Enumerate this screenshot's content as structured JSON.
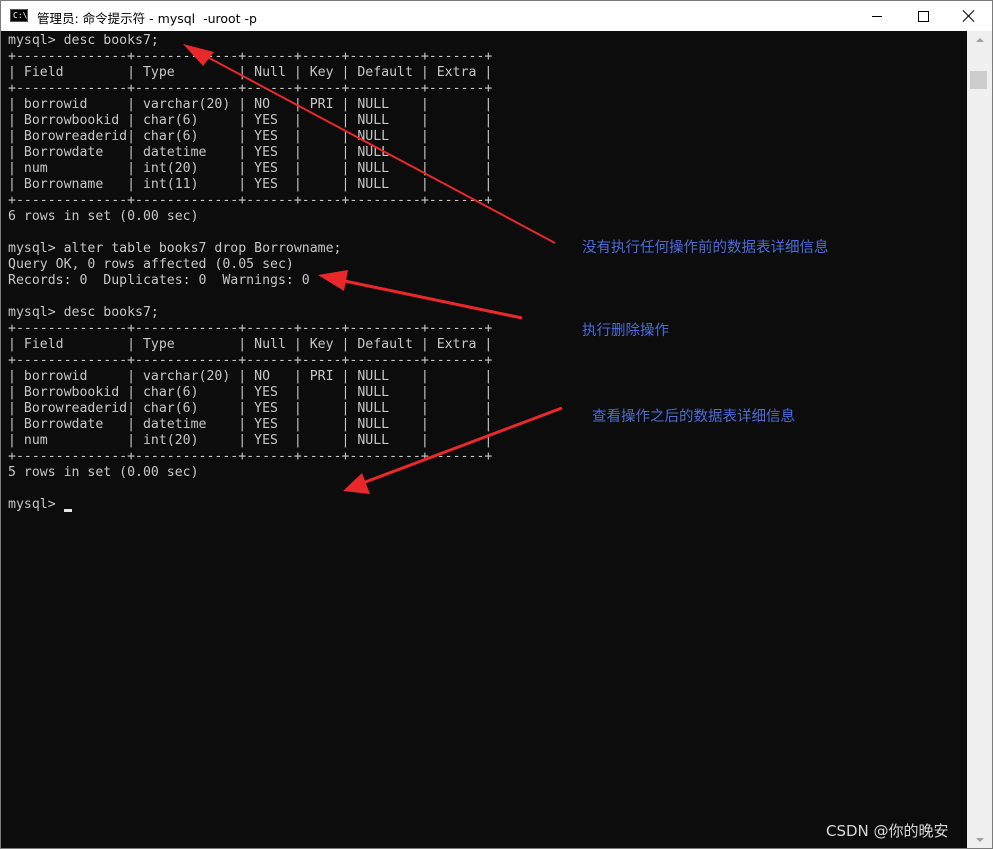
{
  "window": {
    "title": "管理员: 命令提示符 - mysql  -uroot -p",
    "icon_text": "C:\\"
  },
  "terminal": {
    "lines": [
      "mysql> desc books7;",
      "+--------------+-------------+------+-----+---------+-------+",
      "| Field        | Type        | Null | Key | Default | Extra |",
      "+--------------+-------------+------+-----+---------+-------+",
      "| borrowid     | varchar(20) | NO   | PRI | NULL    |       |",
      "| Borrowbookid | char(6)     | YES  |     | NULL    |       |",
      "| Borowreaderid| char(6)     | YES  |     | NULL    |       |",
      "| Borrowdate   | datetime    | YES  |     | NULL    |       |",
      "| num          | int(20)     | YES  |     | NULL    |       |",
      "| Borrowname   | int(11)     | YES  |     | NULL    |       |",
      "+--------------+-------------+------+-----+---------+-------+",
      "6 rows in set (0.00 sec)",
      "",
      "mysql> alter table books7 drop Borrowname;",
      "Query OK, 0 rows affected (0.05 sec)",
      "Records: 0  Duplicates: 0  Warnings: 0",
      "",
      "mysql> desc books7;",
      "+--------------+-------------+------+-----+---------+-------+",
      "| Field        | Type        | Null | Key | Default | Extra |",
      "+--------------+-------------+------+-----+---------+-------+",
      "| borrowid     | varchar(20) | NO   | PRI | NULL    |       |",
      "| Borrowbookid | char(6)     | YES  |     | NULL    |       |",
      "| Borowreaderid| char(6)     | YES  |     | NULL    |       |",
      "| Borrowdate   | datetime    | YES  |     | NULL    |       |",
      "| num          | int(20)     | YES  |     | NULL    |       |",
      "+--------------+-------------+------+-----+---------+-------+",
      "5 rows in set (0.00 sec)",
      "",
      "mysql> "
    ]
  },
  "annotations": {
    "before": "没有执行任何操作前的数据表详细信息",
    "execute": "执行删除操作",
    "after": "查看操作之后的数据表详细信息"
  },
  "watermark": "CSDN @你的晚安",
  "colors": {
    "console_bg": "#0c0c0c",
    "console_text": "#c6c6c6",
    "annotation_text": "#4c6bd8",
    "arrow": "#e8282b"
  }
}
